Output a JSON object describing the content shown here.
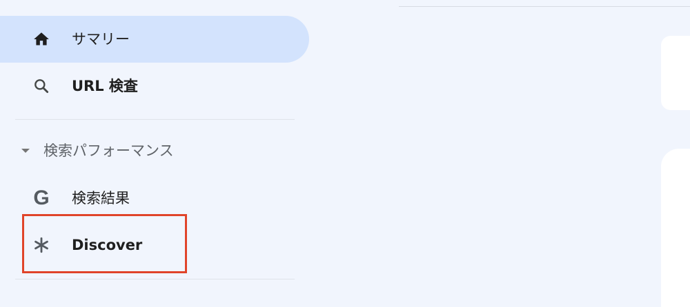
{
  "sidebar": {
    "items": [
      {
        "label": "サマリー",
        "icon": "home-icon",
        "active": true
      },
      {
        "label": "URL 検査",
        "icon": "search-icon",
        "active": false
      }
    ],
    "section": {
      "label": "検索パフォーマンス",
      "icon": "caret-down-icon",
      "expanded": true,
      "items": [
        {
          "label": "検索結果",
          "icon": "google-g-icon",
          "glyph": "G"
        },
        {
          "label": "Discover",
          "icon": "asterisk-icon"
        }
      ]
    }
  },
  "colors": {
    "background": "#f1f5fd",
    "active_item": "#d3e3fd",
    "highlight_box": "#e0442a",
    "card": "#ffffff"
  }
}
